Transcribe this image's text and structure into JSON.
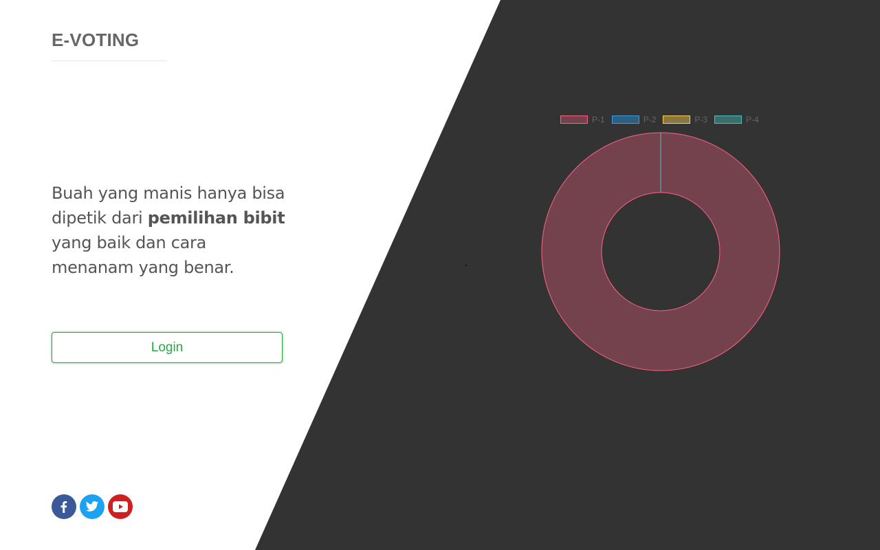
{
  "brand": {
    "title": "E-VOTING"
  },
  "tagline": {
    "part1": "Buah yang manis hanya bisa dipetik dari ",
    "bold": "pemilihan bibit",
    "part2": " yang baik dan cara menanam yang benar."
  },
  "login": {
    "label": "Login"
  },
  "social": [
    {
      "name": "facebook",
      "icon": "facebook-icon",
      "color": "#3b5998"
    },
    {
      "name": "twitter",
      "icon": "twitter-icon",
      "color": "#1da1f2"
    },
    {
      "name": "youtube",
      "icon": "youtube-icon",
      "color": "#cd201f"
    }
  ],
  "colors": {
    "accent": "#28a745",
    "dark_panel": "#333333",
    "text": "#555555"
  },
  "chart_data": {
    "type": "pie",
    "variant": "doughnut",
    "categories": [
      "P-1",
      "P-2",
      "P-3",
      "P-4"
    ],
    "values": [
      100,
      0,
      0,
      0
    ],
    "colors": {
      "fill": [
        "#73424d",
        "#2c5f80",
        "#8a7640",
        "#3a6e6c"
      ],
      "border": [
        "#ff6384",
        "#36a2eb",
        "#ffce56",
        "#4bc0c0"
      ]
    },
    "legend": "top"
  }
}
